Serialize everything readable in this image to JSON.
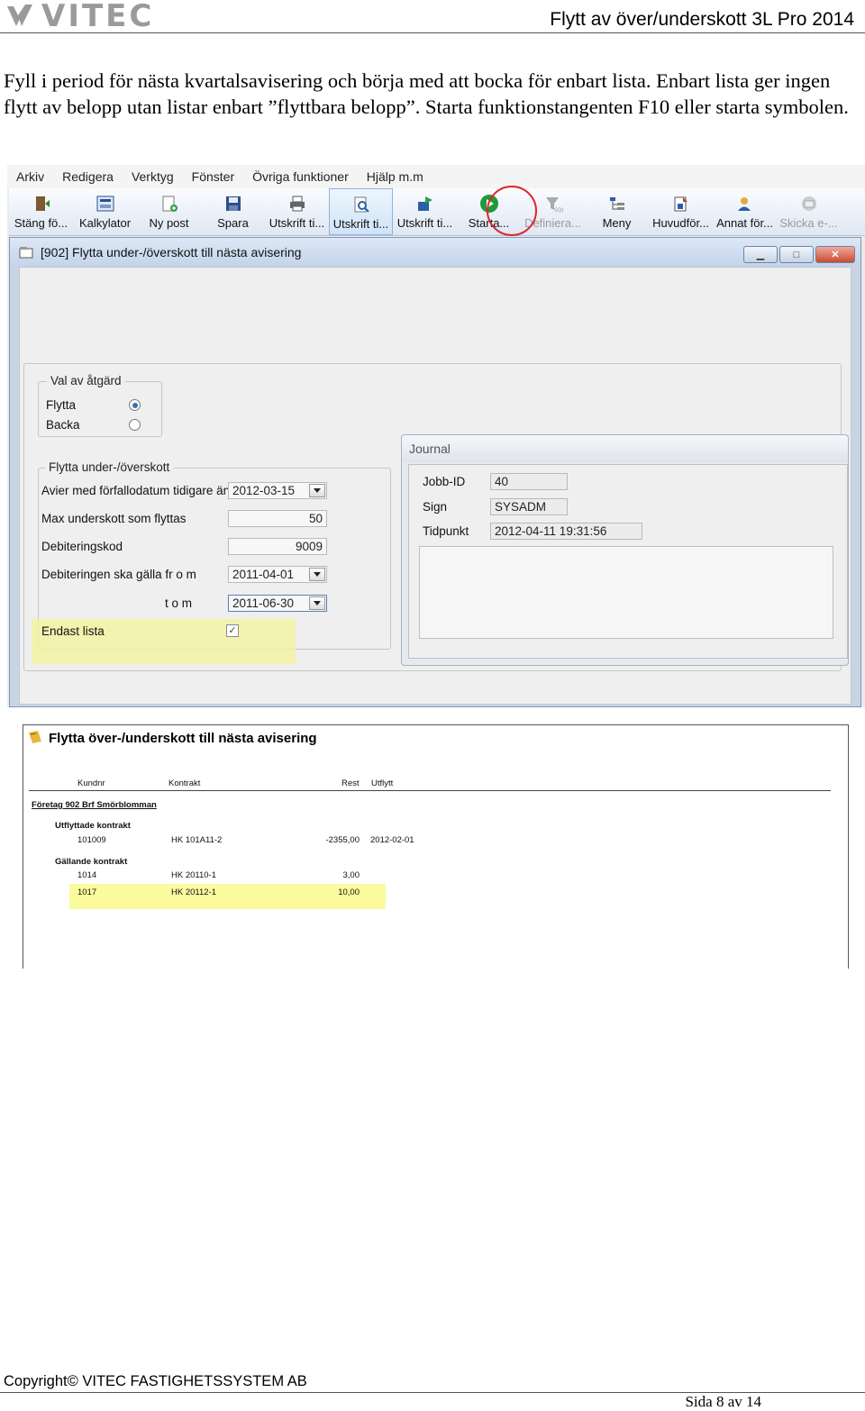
{
  "header": {
    "logo_text": "VITEC",
    "doc_title": "Flytt av över/underskott 3L Pro 2014"
  },
  "intro_text": "Fyll i period för nästa kvartalsavisering och börja med att bocka för enbart lista. Enbart lista ger ingen flytt av belopp utan listar enbart ”flyttbara belopp”. Starta funktionstangenten F10 eller starta symbolen.",
  "app": {
    "menu": [
      "Arkiv",
      "Redigera",
      "Verktyg",
      "Fönster",
      "Övriga funktioner",
      "Hjälp m.m"
    ],
    "toolbar": [
      {
        "label": "Stäng fö...",
        "icon": "door-exit-icon"
      },
      {
        "label": "Kalkylator",
        "icon": "calculator-icon"
      },
      {
        "label": "Ny post",
        "icon": "new-record-icon"
      },
      {
        "label": "Spara",
        "icon": "floppy-save-icon"
      },
      {
        "label": "Utskrift ti...",
        "icon": "printer-icon"
      },
      {
        "label": "Utskrift ti...",
        "icon": "print-preview-icon"
      },
      {
        "label": "Utskrift ti...",
        "icon": "export-icon"
      },
      {
        "label": "Starta...",
        "icon": "play-start-icon"
      },
      {
        "label": "Definiera...",
        "icon": "sql-define-icon"
      },
      {
        "label": "Meny",
        "icon": "menu-tree-icon"
      },
      {
        "label": "Huvudför...",
        "icon": "register-icon"
      },
      {
        "label": "Annat för...",
        "icon": "user-other-icon"
      },
      {
        "label": "Skicka e-...",
        "icon": "send-email-icon"
      }
    ],
    "window_title": "[902]  Flytta under-/överskott till nästa avisering",
    "action_group": {
      "title": "Val av åtgärd",
      "options": [
        {
          "label": "Flytta",
          "selected": true
        },
        {
          "label": "Backa",
          "selected": false
        }
      ]
    },
    "move_group": {
      "title": "Flytta under-/överskott",
      "fields": [
        {
          "label": "Avier med förfallodatum tidigare än",
          "value": "2012-03-15"
        },
        {
          "label": "Max underskott som flyttas",
          "value": "50"
        },
        {
          "label": "Debiteringskod",
          "value": "9009"
        },
        {
          "label": "Debiteringen ska gälla fr o m",
          "value": "2011-04-01"
        },
        {
          "label": "t o m",
          "value": "2011-06-30"
        }
      ],
      "only_list": {
        "label": "Endast lista",
        "checked": true
      }
    },
    "journal": {
      "title": "Journal",
      "fields": [
        {
          "label": "Jobb-ID",
          "value": "40"
        },
        {
          "label": "Sign",
          "value": "SYSADM"
        },
        {
          "label": "Tidpunkt",
          "value": "2012-04-11 19:31:56"
        }
      ]
    }
  },
  "report": {
    "title": "Flytta över-/underskott till nästa avisering",
    "columns": [
      "Kundnr",
      "Kontrakt",
      "Rest",
      "Utflytt"
    ],
    "company": "Företag  902 Brf Smörblomman",
    "sections": [
      {
        "title": "Utflyttade kontrakt",
        "rows": [
          {
            "kundnr": "101009",
            "kontrakt": "HK 101A11-2",
            "rest": "-2355,00",
            "utflytt": "2012-02-01"
          }
        ]
      },
      {
        "title": "Gällande kontrakt",
        "rows": [
          {
            "kundnr": "1014",
            "kontrakt": "HK 20110-1",
            "rest": "3,00",
            "utflytt": ""
          },
          {
            "kundnr": "1017",
            "kontrakt": "HK 20112-1",
            "rest": "10,00",
            "utflytt": ""
          }
        ]
      }
    ]
  },
  "footer": {
    "copyright": "Copyright© VITEC FASTIGHETSSYSTEM AB",
    "page": "Sida 8 av 14"
  }
}
